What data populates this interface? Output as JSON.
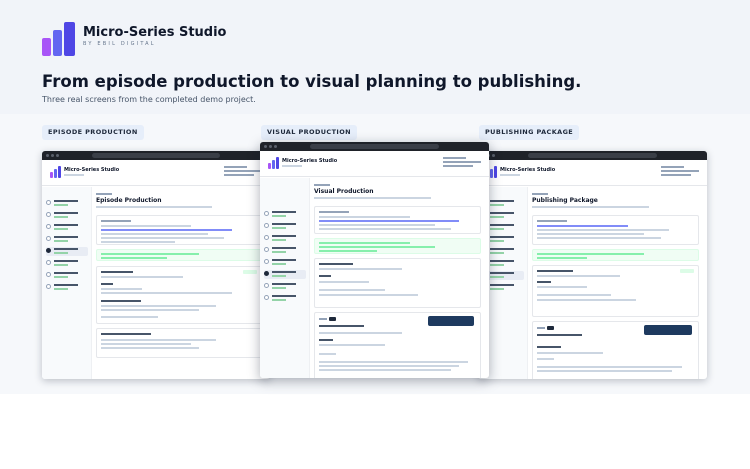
{
  "brand": {
    "name": "Micro-Series Studio",
    "byline": "BY EBIL DIGITAL",
    "logo_colors": [
      "#a855f7",
      "#6366f1",
      "#4f46e5"
    ]
  },
  "hero": {
    "headline": "From episode production to visual planning to publishing.",
    "subline": "Three real screens from the completed demo project."
  },
  "screens": [
    {
      "label": "EPISODE PRODUCTION",
      "page_title": "Episode Production",
      "app_title": "Micro-Series Studio"
    },
    {
      "label": "VISUAL PRODUCTION",
      "page_title": "Visual Production",
      "app_title": "Micro-Series Studio"
    },
    {
      "label": "PUBLISHING PACKAGE",
      "page_title": "Publishing Package",
      "app_title": "Micro-Series Studio"
    }
  ],
  "colors": {
    "accent_dark": "#1e3a5f",
    "chip_bg": "#e6eefa",
    "success": "#86efac"
  }
}
